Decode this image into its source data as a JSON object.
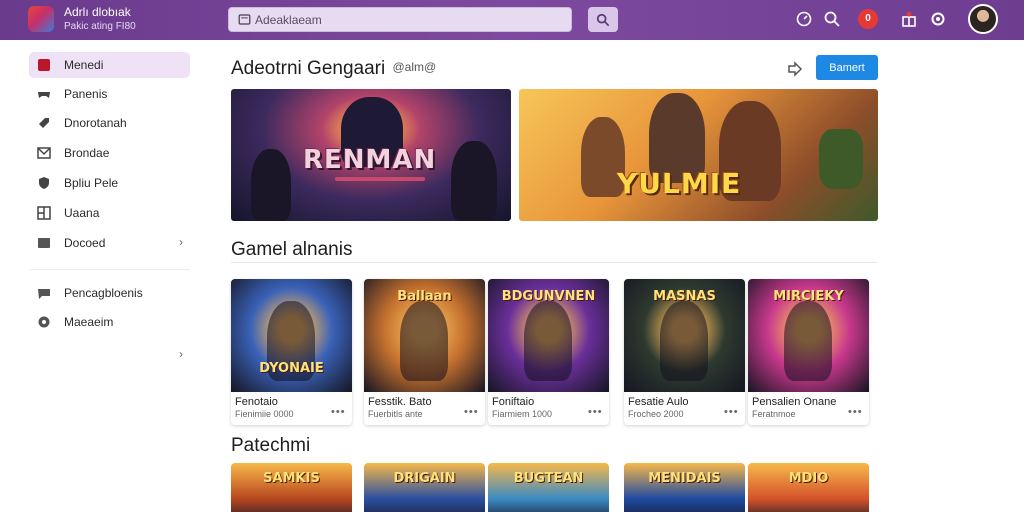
{
  "app": {
    "title": "Adrlı dlobıak",
    "subtitle": "Pakic ating FI80"
  },
  "search": {
    "placeholder": "Adeaklaeam"
  },
  "header": {
    "notification_count": "0"
  },
  "sidebar": {
    "items": [
      {
        "label": "Menedi",
        "active": true
      },
      {
        "label": "Panenis"
      },
      {
        "label": "Dnorotanah"
      },
      {
        "label": "Brondae"
      },
      {
        "label": "Bpliu Pele"
      },
      {
        "label": "Uaana"
      },
      {
        "label": "Docoed",
        "chevron": "›"
      },
      {
        "label": "Pencagbloenis"
      },
      {
        "label": "Maeaeim"
      }
    ],
    "extra_chevron": "›"
  },
  "featured": {
    "title": "Adeotrni Gengaari",
    "badge": "@alm@",
    "button_label": "Bamert",
    "banners": [
      {
        "text": "RENMAN"
      },
      {
        "text": "YULMIE"
      }
    ]
  },
  "games": {
    "title": "Gamel alnanis",
    "cards": [
      {
        "art_text": "DYONAIE",
        "title": "Fenotaio",
        "sub": "Fienimiie 0000",
        "accent": "#3a62b8"
      },
      {
        "art_text": "Ballaan",
        "title": "Fesstik. Bato",
        "sub": "Fuerbitls ante",
        "accent": "#c4702e"
      },
      {
        "art_text": "BDGUNVNEN",
        "title": "Foniftaio",
        "sub": "Fiarmiem 1000",
        "accent": "#6a2f9a"
      },
      {
        "art_text": "MASNAS",
        "title": "Fesatie Aulo",
        "sub": "Frocheo 2000",
        "accent": "#2d3a2f"
      },
      {
        "art_text": "MIRCIEKY",
        "title": "Pensalien Onane",
        "sub": "Feratnmoe",
        "accent": "#c8388c"
      }
    ],
    "more_label": "•••"
  },
  "popular": {
    "title": "Patechmi",
    "cards": [
      {
        "art_text": "SAMKIS",
        "accent": "#b8461e"
      },
      {
        "art_text": "DRIGAIN",
        "accent": "#2a4fa2"
      },
      {
        "art_text": "BUGTEAN",
        "accent": "#3a8ac4"
      },
      {
        "art_text": "MENIDAIS",
        "accent": "#1e4aa2"
      },
      {
        "art_text": "MDIO",
        "accent": "#d4522a"
      }
    ]
  },
  "colors": {
    "topbar": "#7d4aa0",
    "accent": "#1e88e5",
    "sidebar_active": "#efe2f6"
  }
}
